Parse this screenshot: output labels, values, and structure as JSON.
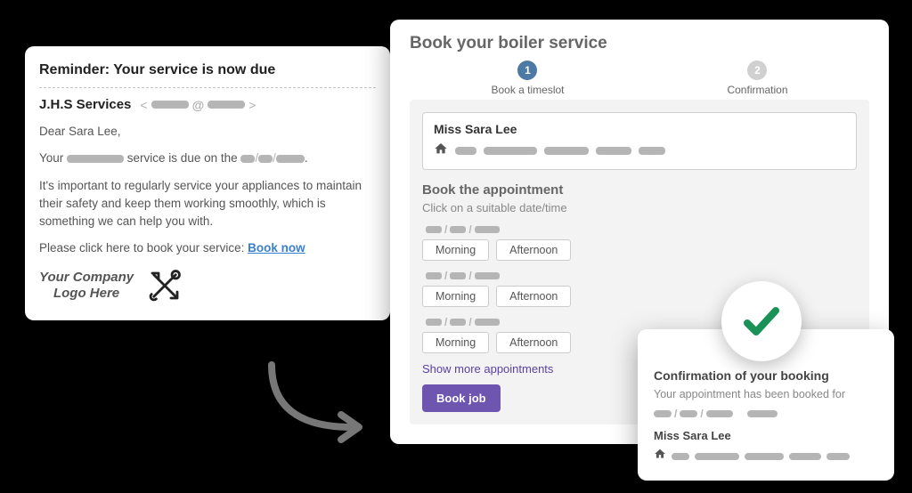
{
  "email": {
    "subject": "Reminder: Your service is now due",
    "from_name": "J.H.S Services",
    "greeting": "Dear Sara Lee,",
    "line_pre": "Your ",
    "line_mid": " service is due on the ",
    "detail": "It's important to regularly service your appliances to maintain their safety and keep them working smoothly, which is something we can help you with.",
    "cta_text": "Please click here to book your service: ",
    "cta_link": "Book now",
    "logo_line1": "Your Company",
    "logo_line2": "Logo Here"
  },
  "booking": {
    "title": "Book your boiler service",
    "steps": [
      {
        "num": "1",
        "label": "Book a timeslot"
      },
      {
        "num": "2",
        "label": "Confirmation"
      }
    ],
    "customer_name": "Miss Sara Lee",
    "section_title": "Book the appointment",
    "section_sub": "Click on a suitable date/time",
    "slots": [
      {
        "morning": "Morning",
        "afternoon": "Afternoon"
      },
      {
        "morning": "Morning",
        "afternoon": "Afternoon"
      },
      {
        "morning": "Morning",
        "afternoon": "Afternoon"
      }
    ],
    "show_more": "Show more appointments",
    "book_btn": "Book job"
  },
  "confirmation": {
    "title": "Confirmation of your booking",
    "sub": "Your appointment has been booked for",
    "name": "Miss Sara Lee"
  }
}
